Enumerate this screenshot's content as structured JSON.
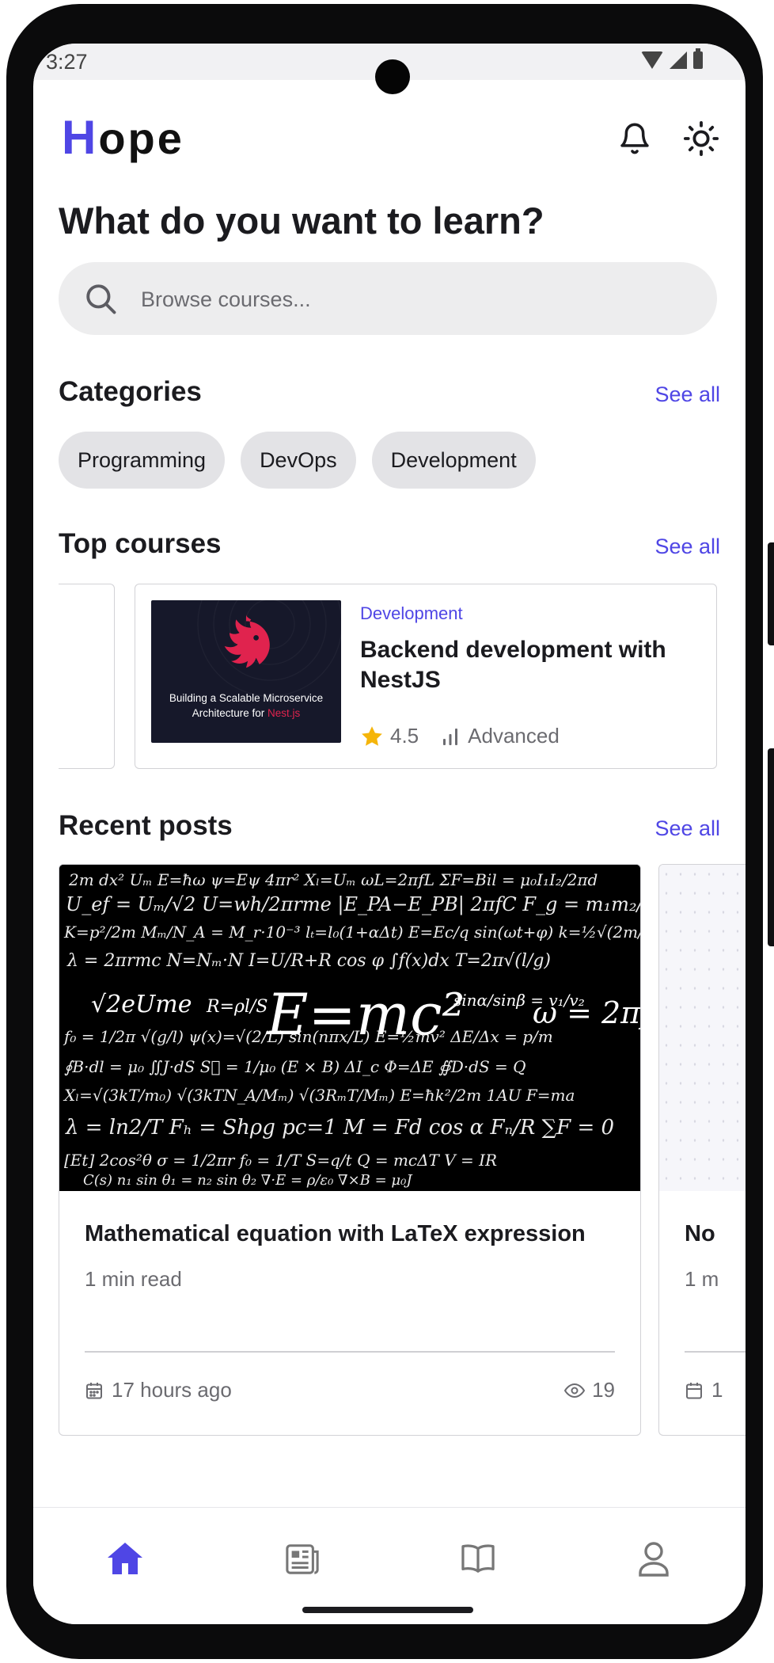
{
  "status_bar": {
    "time": "3:27"
  },
  "header": {
    "logo_first": "H",
    "logo_rest": "ope",
    "notifications_icon": "bell-icon",
    "theme_icon": "sun-icon"
  },
  "headline": "What do you want to learn?",
  "search": {
    "placeholder": "Browse courses...",
    "value": ""
  },
  "categories": {
    "title": "Categories",
    "see_all": "See all",
    "items": [
      "Programming",
      "DevOps",
      "Development"
    ]
  },
  "top_courses": {
    "title": "Top courses",
    "see_all": "See all",
    "courses": [
      {
        "thumbnail_line1": "Building a Scalable Microservice",
        "thumbnail_line2": "Architecture for ",
        "thumbnail_brand": "Nest.js",
        "category": "Development",
        "title": "Backend development with NestJS",
        "rating": "4.5",
        "level": "Advanced"
      }
    ]
  },
  "recent_posts": {
    "title": "Recent posts",
    "see_all": "See all",
    "posts": [
      {
        "image_text": "E=mc²",
        "title": "Mathematical equation with LaTeX expression",
        "read_time": "1 min read",
        "date": "17 hours ago",
        "views": "19"
      },
      {
        "title": "No",
        "read_time": "1 m",
        "date": "1"
      }
    ]
  },
  "bottom_nav": {
    "items": [
      {
        "icon": "home-icon",
        "active": true
      },
      {
        "icon": "newspaper-icon",
        "active": false
      },
      {
        "icon": "book-icon",
        "active": false
      },
      {
        "icon": "user-icon",
        "active": false
      }
    ]
  },
  "colors": {
    "accent": "#4f46e5",
    "star": "#f5b50a",
    "text": "#1b1b1f",
    "muted": "#6b6b70",
    "chip_bg": "#e3e3e6",
    "search_bg": "#ededee"
  }
}
